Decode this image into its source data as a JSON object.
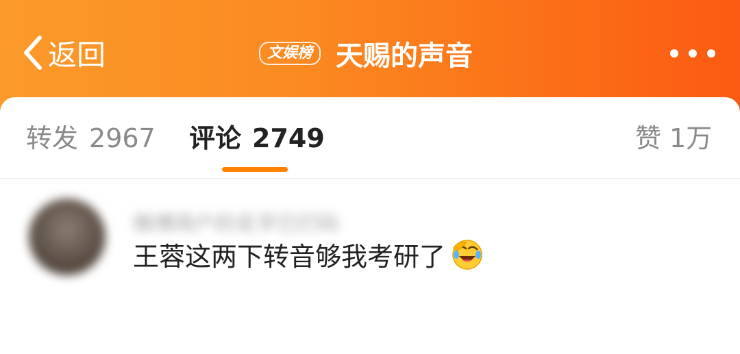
{
  "header": {
    "back_label": "返回",
    "tag": "文娱榜",
    "title": "天赐的声音"
  },
  "tabs": {
    "repost": {
      "label": "转发",
      "count": "2967"
    },
    "comment": {
      "label": "评论",
      "count": "2749"
    },
    "like": {
      "label": "赞",
      "count": "1万"
    }
  },
  "comment": {
    "username": "微博用户的名字已打码",
    "text": "王蓉这两下转音够我考研了",
    "emoji": "laugh-cry-emoji"
  },
  "colors": {
    "header_gradient_start": "#fb9a2a",
    "header_gradient_end": "#fb5a12",
    "active_tab_indicator": "#ff8200"
  }
}
